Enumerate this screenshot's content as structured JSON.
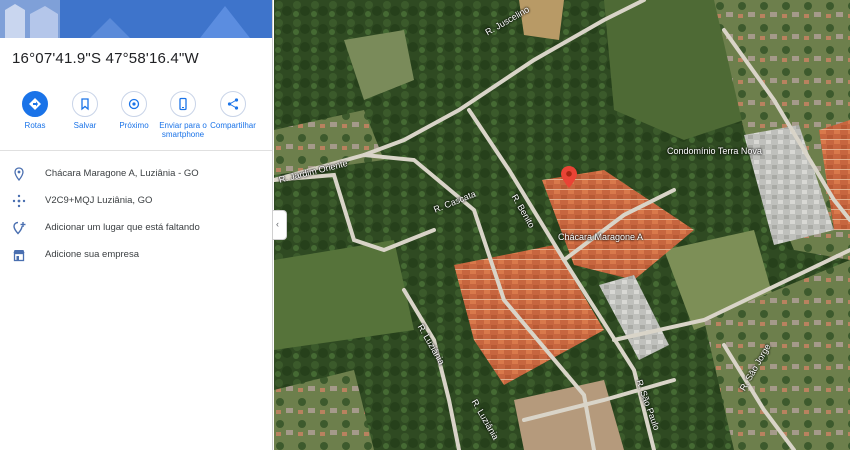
{
  "panel": {
    "coordinates": "16°07'41.9\"S 47°58'16.4\"W",
    "actions": [
      {
        "label": "Rotas",
        "icon": "directions-icon"
      },
      {
        "label": "Salvar",
        "icon": "bookmark-icon"
      },
      {
        "label": "Próximo",
        "icon": "nearby-icon"
      },
      {
        "label": "Enviar para o smartphone",
        "icon": "send-to-phone-icon"
      },
      {
        "label": "Compartilhar",
        "icon": "share-icon"
      }
    ],
    "info": [
      {
        "text": "Chácara Maragone A, Luziânia - GO",
        "icon": "location-pin-icon"
      },
      {
        "text": "V2C9+MQJ Luziânia, GO",
        "icon": "plus-code-icon"
      },
      {
        "text": "Adicionar um lugar que está faltando",
        "icon": "add-place-icon"
      },
      {
        "text": "Adicione sua empresa",
        "icon": "business-icon"
      }
    ],
    "collapse_glyph": "‹"
  },
  "map": {
    "pin_color": "#ea4335",
    "labels": {
      "condominio": "Condomínio Terra Nova",
      "place_near_pin": "Chácara Maragone A",
      "street_top": "R. Juscelino",
      "street_left": "R. Jardim Oriente",
      "street_mid": "R. Cascata",
      "street_vert": "R. Benito",
      "street_lower": "R. Luziânia",
      "street_lower2": "R. Luziânia",
      "street_right": "R. São Paulo",
      "street_right2": "R. São Jorge"
    }
  }
}
